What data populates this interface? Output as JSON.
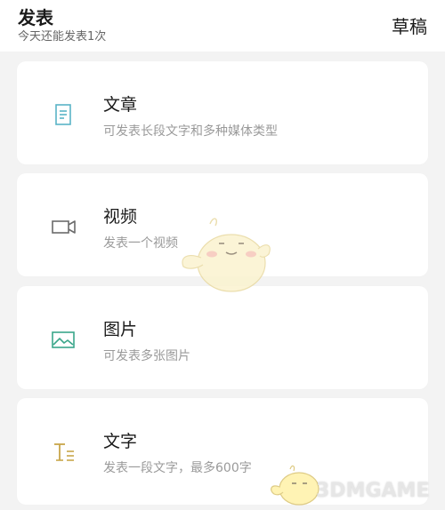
{
  "header": {
    "title": "发表",
    "subtitle": "今天还能发表1次",
    "drafts_label": "草稿"
  },
  "options": [
    {
      "label": "文章",
      "desc": "可发表长段文字和多种媒体类型",
      "icon": "article-icon",
      "icon_color": "#5ab4c6"
    },
    {
      "label": "视频",
      "desc": "发表一个视频",
      "icon": "video-camera-icon",
      "icon_color": "#6b6b6b"
    },
    {
      "label": "图片",
      "desc": "可发表多张图片",
      "icon": "image-icon",
      "icon_color": "#3aa68a"
    },
    {
      "label": "文字",
      "desc": "发表一段文字，最多600字",
      "icon": "text-icon",
      "icon_color": "#c8a64a"
    }
  ],
  "watermark": {
    "text": "3DMGAME"
  }
}
